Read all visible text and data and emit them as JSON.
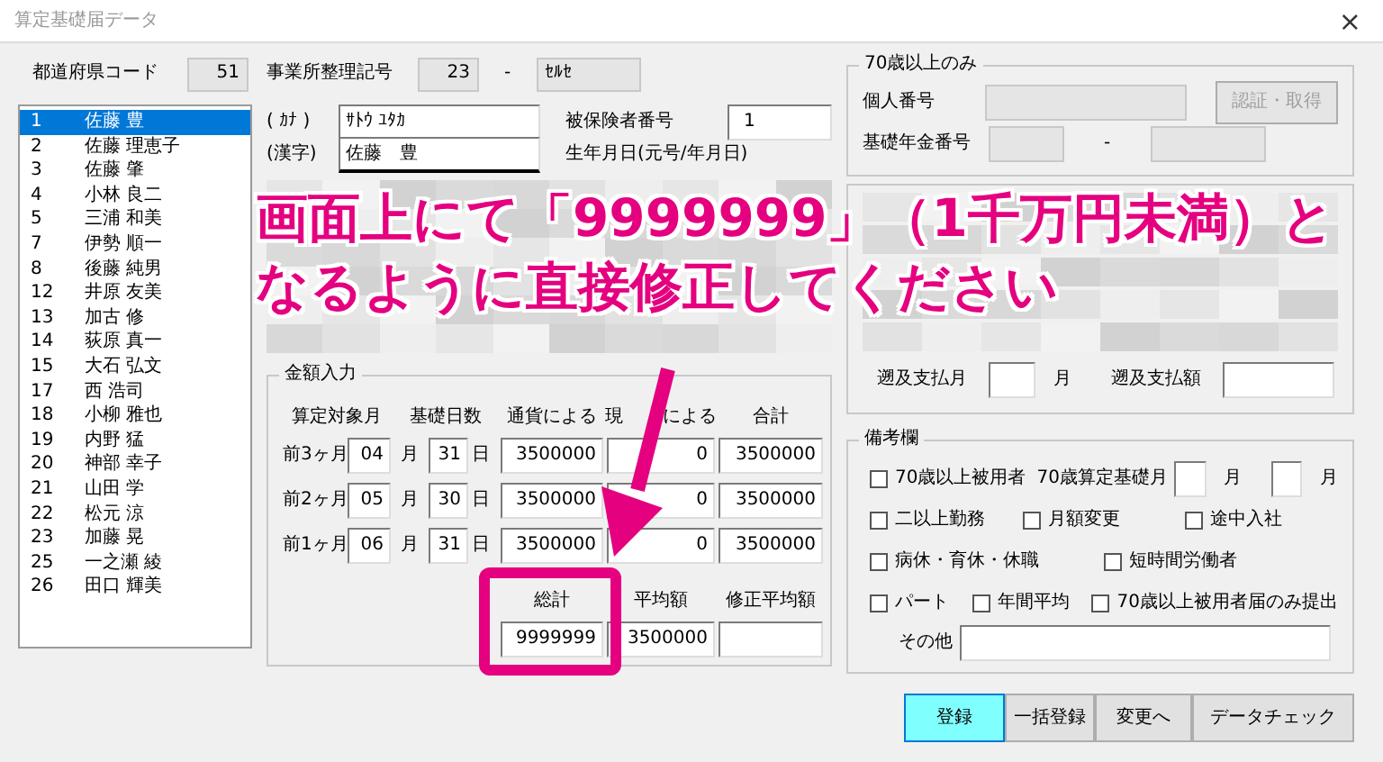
{
  "window": {
    "title": "算定基礎届データ",
    "close": "×"
  },
  "header": {
    "prefecture_code_label": "都道府県コード",
    "prefecture_code": "51",
    "office_symbol_label": "事業所整理記号",
    "office_symbol_1": "23",
    "separator": "-",
    "office_symbol_2": "ｾﾙｾ"
  },
  "employees": [
    {
      "number": "1",
      "name": "佐藤 豊",
      "selected": true
    },
    {
      "number": "2",
      "name": "佐藤 理恵子",
      "selected": false
    },
    {
      "number": "3",
      "name": "佐藤 肇",
      "selected": false
    },
    {
      "number": "4",
      "name": "小林 良二",
      "selected": false
    },
    {
      "number": "5",
      "name": "三浦 和美",
      "selected": false
    },
    {
      "number": "7",
      "name": "伊勢 順一",
      "selected": false
    },
    {
      "number": "8",
      "name": "後藤 純男",
      "selected": false
    },
    {
      "number": "12",
      "name": "井原 友美",
      "selected": false
    },
    {
      "number": "13",
      "name": "加古 修",
      "selected": false
    },
    {
      "number": "14",
      "name": "荻原 真一",
      "selected": false
    },
    {
      "number": "15",
      "name": "大石 弘文",
      "selected": false
    },
    {
      "number": "17",
      "name": "西 浩司",
      "selected": false
    },
    {
      "number": "18",
      "name": "小柳 雅也",
      "selected": false
    },
    {
      "number": "19",
      "name": "内野 猛",
      "selected": false
    },
    {
      "number": "20",
      "name": "神部 幸子",
      "selected": false
    },
    {
      "number": "21",
      "name": "山田 学",
      "selected": false
    },
    {
      "number": "22",
      "name": "松元 涼",
      "selected": false
    },
    {
      "number": "23",
      "name": "加藤 晃",
      "selected": false
    },
    {
      "number": "25",
      "name": "一之瀬 綾",
      "selected": false
    },
    {
      "number": "26",
      "name": "田口 輝美",
      "selected": false
    }
  ],
  "person": {
    "kana_label": "( ｶﾅ )",
    "kana": "ｻﾄｳ ﾕﾀｶ",
    "kanji_label": "(漢字)",
    "kanji": "佐藤　豊",
    "insured_number_label": "被保険者番号",
    "insured_number": "1",
    "birth_label": "生年月日(元号/年月日)"
  },
  "over70": {
    "legend": "70歳以上のみ",
    "my_number_label": "個人番号",
    "auth_button": "認証・取得",
    "auth_disabled": true,
    "pension_label": "基礎年金番号",
    "separator": "-"
  },
  "retro": {
    "month_label": "遡及支払月",
    "month_unit": "月",
    "amount_label": "遡及支払額"
  },
  "amounts": {
    "legend": "金額入力",
    "headers": [
      {
        "parts": [
          "算定対象月"
        ]
      },
      {
        "parts": [
          "基礎日数"
        ]
      },
      {
        "parts": [
          "通貨による"
        ]
      },
      {
        "parts": [
          "現",
          "による"
        ]
      },
      {
        "parts": [
          "合計"
        ]
      }
    ],
    "rows": [
      {
        "label": "前3ヶ月",
        "month": "04",
        "month_unit": "月",
        "days": "31",
        "day_unit": "日",
        "currency": "3500000",
        "in_kind": "0",
        "total": "3500000"
      },
      {
        "label": "前2ヶ月",
        "month": "05",
        "month_unit": "月",
        "days": "30",
        "day_unit": "日",
        "currency": "3500000",
        "in_kind": "0",
        "total": "3500000"
      },
      {
        "label": "前1ヶ月",
        "month": "06",
        "month_unit": "月",
        "days": "31",
        "day_unit": "日",
        "currency": "3500000",
        "in_kind": "0",
        "total": "3500000"
      }
    ],
    "summary_headers": [
      "総計",
      "平均額",
      "修正平均額"
    ],
    "grand_total": "9999999",
    "average": "3500000"
  },
  "remarks": {
    "legend": "備考欄",
    "base_month_label": "70歳算定基礎月",
    "month_unit_1": "月",
    "month_unit_2": "月",
    "other_label": "その他",
    "rows": [
      [
        {
          "label": "70歳以上被用者",
          "checked": false
        }
      ],
      [
        {
          "label": "二以上勤務",
          "checked": false
        },
        {
          "label": "月額変更",
          "checked": false
        },
        {
          "label": "途中入社",
          "checked": false
        }
      ],
      [
        {
          "label": "病休・育休・休職",
          "checked": false
        },
        {
          "label": "短時間労働者",
          "checked": false
        }
      ],
      [
        {
          "label": "パート",
          "checked": false
        },
        {
          "label": "年間平均",
          "checked": false
        },
        {
          "label": "70歳以上被用者届のみ提出",
          "checked": false
        }
      ]
    ]
  },
  "buttons": [
    {
      "label": "登録",
      "highlighted": true
    },
    {
      "label": "一括登録",
      "highlighted": false
    },
    {
      "label": "変更へ",
      "highlighted": false
    },
    {
      "label": "データチェック",
      "highlighted": false
    }
  ],
  "annotation": {
    "lines": [
      "画面上にて「9999999」（1千万円未満）と",
      "なるように直接修正してください"
    ]
  }
}
